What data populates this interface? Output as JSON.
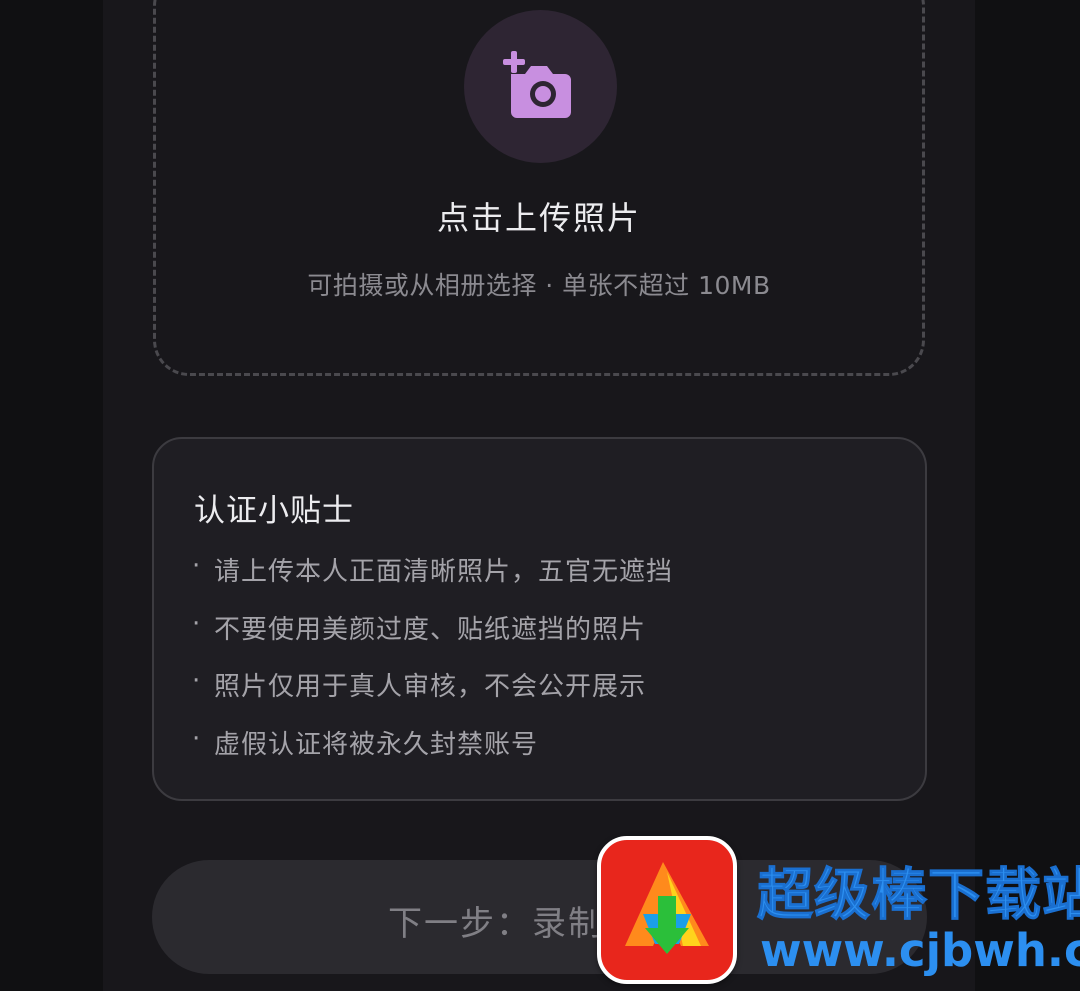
{
  "upload": {
    "icon": "add-photo-icon",
    "title": "点击上传照片",
    "subtitle": "可拍摄或从相册选择 · 单张不超过 10MB"
  },
  "tips": {
    "title": "认证小贴士",
    "bullet": "·",
    "items": [
      "请上传本人正面清晰照片，五官无遮挡",
      "不要使用美颜过度、贴纸遮挡的照片",
      "照片仅用于真人审核，不会公开展示",
      "虚假认证将被永久封禁账号"
    ]
  },
  "next_button": {
    "label": "下一步：录制"
  },
  "watermark": {
    "title": "超级棒下载站",
    "url": "www.cjbwh.com"
  },
  "colors": {
    "background": "#101012",
    "panel": "#18171b",
    "accent_icon": "#c88fe0",
    "watermark_blue": "#2c8ff0",
    "watermark_red": "#e8261c"
  }
}
